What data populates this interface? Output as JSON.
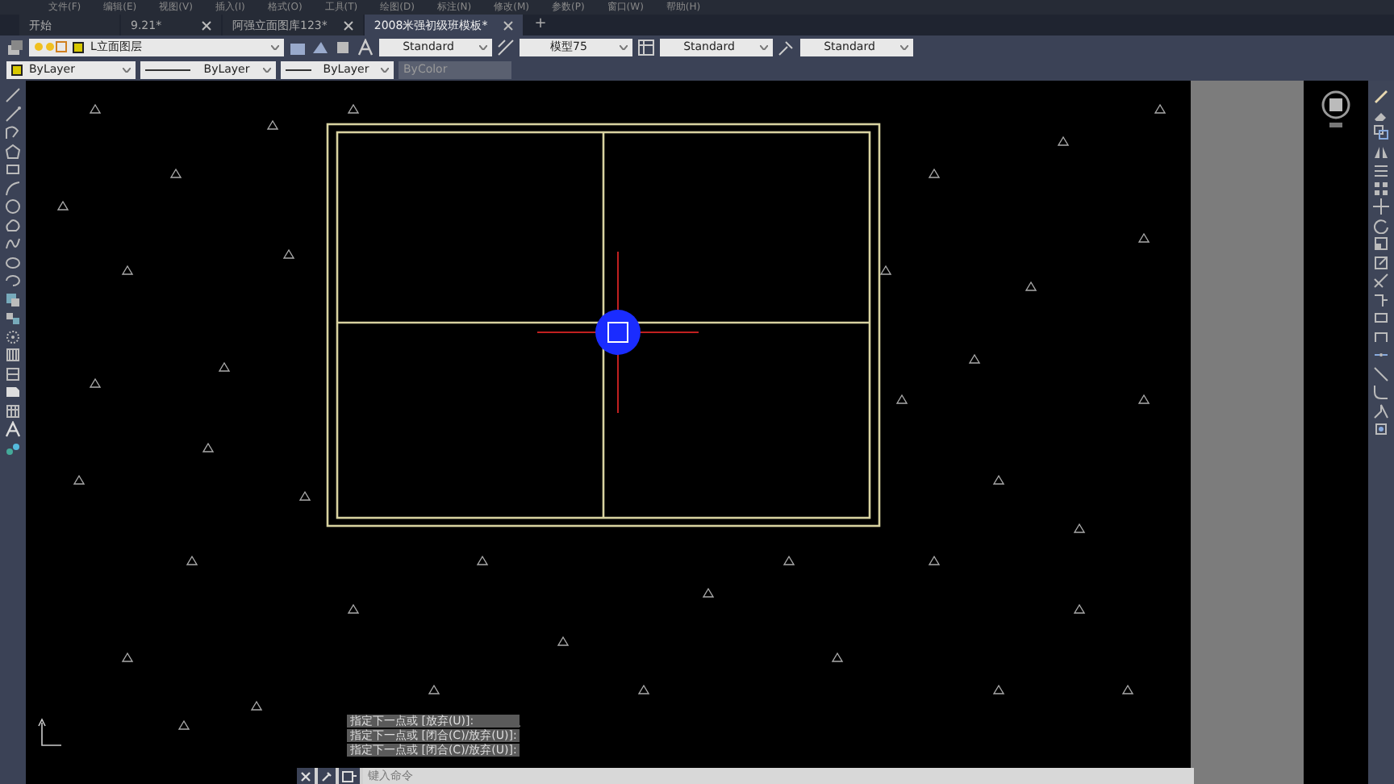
{
  "menu": [
    "文件(F)",
    "编辑(E)",
    "视图(V)",
    "插入(I)",
    "格式(O)",
    "工具(T)",
    "绘图(D)",
    "标注(N)",
    "修改(M)",
    "参数(P)",
    "窗口(W)",
    "帮助(H)"
  ],
  "tabs": [
    {
      "label": "开始",
      "selected": false,
      "closable": false
    },
    {
      "label": "9.21*",
      "selected": false,
      "closable": true
    },
    {
      "label": "阿强立面图库123*",
      "selected": false,
      "closable": true
    },
    {
      "label": "2008米强初级班模板*",
      "selected": true,
      "closable": true
    }
  ],
  "new_tab": "+",
  "styles_toolbar": {
    "layer": "L立面图层",
    "text_style": "Standard",
    "dim_style": "模型75",
    "table_style": "Standard",
    "multileader_style": "Standard"
  },
  "properties_toolbar": {
    "color_setting": "ByLayer",
    "linetype": "ByLayer",
    "lineweight": "ByLayer",
    "plot_style": "ByColor"
  },
  "command_history": [
    "指定下一点或 [放弃(U)]:",
    "指定下一点或 [闭合(C)/放弃(U)]:",
    "指定下一点或 [闭合(C)/放弃(U)]:"
  ],
  "command_line": {
    "placeholder": "键入命令"
  }
}
